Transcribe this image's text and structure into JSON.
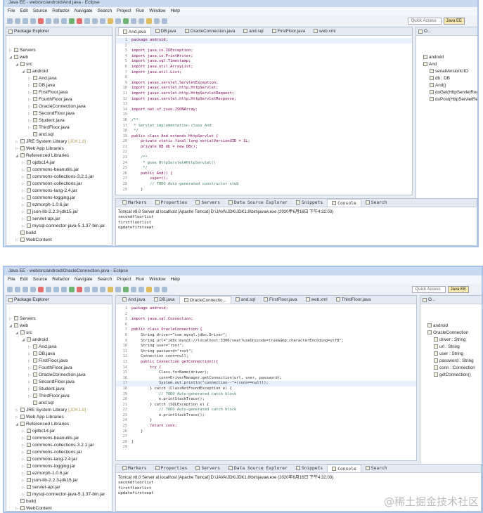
{
  "windows": [
    {
      "title": "Java EE - web/src/android/And.java - Eclipse",
      "menu": [
        "File",
        "Edit",
        "Source",
        "Refactor",
        "Navigate",
        "Search",
        "Project",
        "Run",
        "Window",
        "Help"
      ],
      "quick_access": "Quick Access",
      "perspective": "Java EE",
      "explorer_title": "Package Explorer",
      "editor_tabs": [
        "And.java",
        "DB.java",
        "OracleConnection.java",
        "and.sql",
        "FirstFloor.java",
        "web.xml"
      ],
      "active_tab": 0,
      "code": [
        [
          1,
          "package android;"
        ],
        [
          2,
          ""
        ],
        [
          3,
          "import java.io.IOException;"
        ],
        [
          4,
          "import java.io.PrintWriter;"
        ],
        [
          5,
          "import java.sql.Timestamp;"
        ],
        [
          6,
          "import java.util.ArrayList;"
        ],
        [
          7,
          "import java.util.List;"
        ],
        [
          8,
          ""
        ],
        [
          9,
          "import javax.servlet.ServletException;"
        ],
        [
          10,
          "import javax.servlet.http.HttpServlet;"
        ],
        [
          11,
          "import javax.servlet.http.HttpServletRequest;"
        ],
        [
          12,
          "import javax.servlet.http.HttpServletResponse;"
        ],
        [
          13,
          ""
        ],
        [
          14,
          "import net.sf.json.JSONArray;"
        ],
        [
          15,
          ""
        ],
        [
          16,
          "/**"
        ],
        [
          17,
          " * Servlet implementation class And"
        ],
        [
          18,
          " */"
        ],
        [
          19,
          "public class And extends HttpServlet {"
        ],
        [
          20,
          "    private static final long serialVersionUID = 1L;"
        ],
        [
          21,
          "    private DB db = new DB();"
        ],
        [
          22,
          ""
        ],
        [
          23,
          "    /**"
        ],
        [
          24,
          "     * @see HttpServlet#HttpServlet()"
        ],
        [
          25,
          "     */"
        ],
        [
          26,
          "    public And() {"
        ],
        [
          27,
          "        super();"
        ],
        [
          28,
          "        // TODO Auto-generated constructor stub"
        ],
        [
          29,
          "    }"
        ]
      ],
      "highlight_line": 0,
      "outline_title": "O...",
      "outline": [
        {
          "label": "android",
          "depth": 0
        },
        {
          "label": "And",
          "depth": 0
        },
        {
          "label": "serialVersionUID",
          "depth": 1
        },
        {
          "label": "db : DB",
          "depth": 1
        },
        {
          "label": "And()",
          "depth": 1
        },
        {
          "label": "doGet(HttpServletRequest",
          "depth": 1
        },
        {
          "label": "doPost(HttpServletRequest",
          "depth": 1
        }
      ]
    },
    {
      "title": "Java EE - web/src/android/OracleConnection.java - Eclipse",
      "menu": [
        "File",
        "Edit",
        "Source",
        "Refactor",
        "Navigate",
        "Search",
        "Project",
        "Run",
        "Window",
        "Help"
      ],
      "quick_access": "Quick Access",
      "perspective": "Java EE",
      "explorer_title": "Package Explorer",
      "editor_tabs": [
        "And.java",
        "DB.java",
        "OracleConnectio...",
        "and.sql",
        "FirstFloor.java",
        "web.xml",
        "ThirdFloor.java"
      ],
      "active_tab": 2,
      "code": [
        [
          1,
          "package android;"
        ],
        [
          2,
          ""
        ],
        [
          3,
          "import java.sql.Connection;"
        ],
        [
          6,
          ""
        ],
        [
          7,
          "public class OracleConnection {"
        ],
        [
          8,
          "    String driver=\"com.mysql.jdbc.Driver\";"
        ],
        [
          9,
          "    String url=\"jdbc:mysql://localhost:3306/seat?useUnicode=true&amp;characterEncoding=utf8\";"
        ],
        [
          10,
          "    String user=\"root\";"
        ],
        [
          11,
          "    String password=\"root\";"
        ],
        [
          12,
          "    Connection conn=null;"
        ],
        [
          13,
          "    public Connection getConnection(){"
        ],
        [
          14,
          "        try {"
        ],
        [
          15,
          "            Class.forName(driver);"
        ],
        [
          16,
          "            conn=DriverManager.getConnection(url, user, password);"
        ],
        [
          17,
          "            System.out.println(\"connection--\"+(conn==null));"
        ],
        [
          18,
          "        } catch (ClassNotFoundException e) {"
        ],
        [
          19,
          "            // TODO Auto-generated catch block"
        ],
        [
          20,
          "            e.printStackTrace();"
        ],
        [
          21,
          "        } catch (SQLException e) {"
        ],
        [
          22,
          "            // TODO Auto-generated catch block"
        ],
        [
          23,
          "            e.printStackTrace();"
        ],
        [
          24,
          "        }"
        ],
        [
          25,
          "        return conn;"
        ],
        [
          26,
          "    }"
        ],
        [
          27,
          ""
        ],
        [
          28,
          "}"
        ],
        [
          29,
          ""
        ]
      ],
      "highlight_line": 14,
      "outline_title": "O...",
      "outline": [
        {
          "label": "android",
          "depth": 0
        },
        {
          "label": "OracleConnection",
          "depth": 0
        },
        {
          "label": "driver : String",
          "depth": 1
        },
        {
          "label": "url : String",
          "depth": 1
        },
        {
          "label": "user : String",
          "depth": 1
        },
        {
          "label": "password : String",
          "depth": 1
        },
        {
          "label": "conn : Connection",
          "depth": 1
        },
        {
          "label": "getConnection()",
          "depth": 1
        }
      ]
    }
  ],
  "tree": [
    {
      "label": "Servers",
      "depth": 0,
      "tw": "▷"
    },
    {
      "label": "web",
      "depth": 0,
      "tw": "◢"
    },
    {
      "label": "src",
      "depth": 1,
      "tw": "◢"
    },
    {
      "label": "android",
      "depth": 2,
      "tw": "◢"
    },
    {
      "label": "And.java",
      "depth": 3,
      "tw": "▷"
    },
    {
      "label": "DB.java",
      "depth": 3,
      "tw": "▷"
    },
    {
      "label": "FirstFloor.java",
      "depth": 3,
      "tw": "▷"
    },
    {
      "label": "FourthFloor.java",
      "depth": 3,
      "tw": "▷"
    },
    {
      "label": "OracleConnection.java",
      "depth": 3,
      "tw": "▷"
    },
    {
      "label": "SecondFloor.java",
      "depth": 3,
      "tw": "▷"
    },
    {
      "label": "Student.java",
      "depth": 3,
      "tw": "▷"
    },
    {
      "label": "ThirdFloor.java",
      "depth": 3,
      "tw": "▷"
    },
    {
      "label": "and.sql",
      "depth": 3,
      "tw": ""
    },
    {
      "label": "JRE System Library",
      "extra": "[JDK1.8]",
      "depth": 1,
      "tw": "▷"
    },
    {
      "label": "Web App Libraries",
      "depth": 1,
      "tw": "▷"
    },
    {
      "label": "Referenced Libraries",
      "depth": 1,
      "tw": "◢"
    },
    {
      "label": "ojdbc14.jar",
      "depth": 2,
      "tw": "▷"
    },
    {
      "label": "commons-beanutils.jar",
      "depth": 2,
      "tw": "▷"
    },
    {
      "label": "commons-collections-3.2.1.jar",
      "depth": 2,
      "tw": "▷"
    },
    {
      "label": "commons-collections.jar",
      "depth": 2,
      "tw": "▷"
    },
    {
      "label": "commons-lang-2.4.jar",
      "depth": 2,
      "tw": "▷"
    },
    {
      "label": "commons-logging.jar",
      "depth": 2,
      "tw": "▷"
    },
    {
      "label": "ezmorph-1.0.6.jar",
      "depth": 2,
      "tw": "▷"
    },
    {
      "label": "json-lib-2.2.3-jdk15.jar",
      "depth": 2,
      "tw": "▷"
    },
    {
      "label": "servlet-api.jar",
      "depth": 2,
      "tw": "▷"
    },
    {
      "label": "mysql-connector-java-5.1.37-bin.jar",
      "depth": 2,
      "tw": "▷"
    },
    {
      "label": "build",
      "depth": 1,
      "tw": ""
    },
    {
      "label": "WebContent",
      "depth": 1,
      "tw": "▷"
    }
  ],
  "console": {
    "tabs": [
      "Markers",
      "Properties",
      "Servers",
      "Data Source Explorer",
      "Snippets",
      "Console",
      "Search"
    ],
    "active": 5,
    "header": "Tomcat v8.0 Server at localhost [Apache Tomcat] D:\\JAVA\\JDK\\JDK1.8\\bin\\javaw.exe (2020年6月16日 下午4:32:03)",
    "lines": [
      "secondfloorlist",
      "firstfloorlist",
      "updatefirstseat"
    ]
  },
  "watermark": "@稀土掘金技术社区"
}
